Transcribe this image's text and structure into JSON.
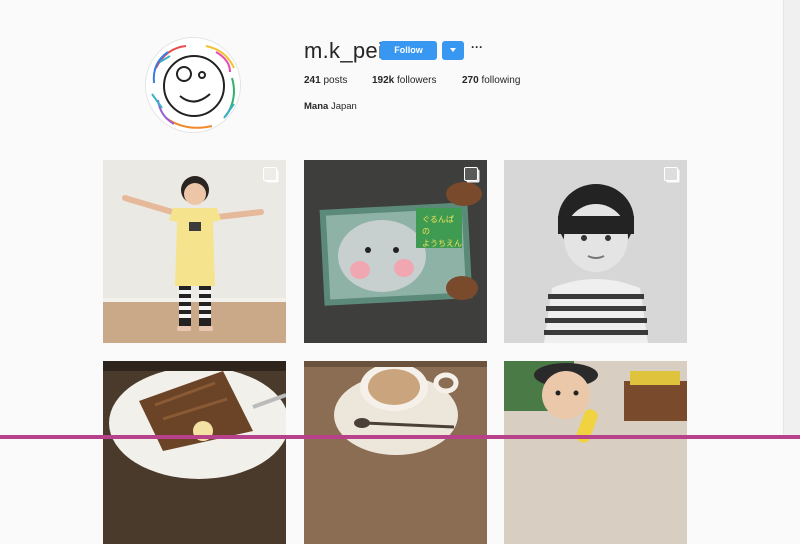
{
  "profile": {
    "username": "m.k_pei",
    "follow_label": "Follow",
    "more_label": "···",
    "posts_count": "241",
    "posts_label": "posts",
    "followers_count": "192k",
    "followers_label": "followers",
    "following_count": "270",
    "following_label": "following",
    "bio_name": "Mana",
    "bio_location": "Japan"
  },
  "colors": {
    "accent": "#3897f0",
    "background": "#fafafa",
    "bottom_bar": "#b8418c"
  },
  "posts": [
    {
      "alt_icon": "multi-image-icon"
    },
    {
      "alt_icon": "multi-image-icon"
    },
    {
      "alt_icon": "multi-image-icon"
    },
    {},
    {},
    {}
  ]
}
